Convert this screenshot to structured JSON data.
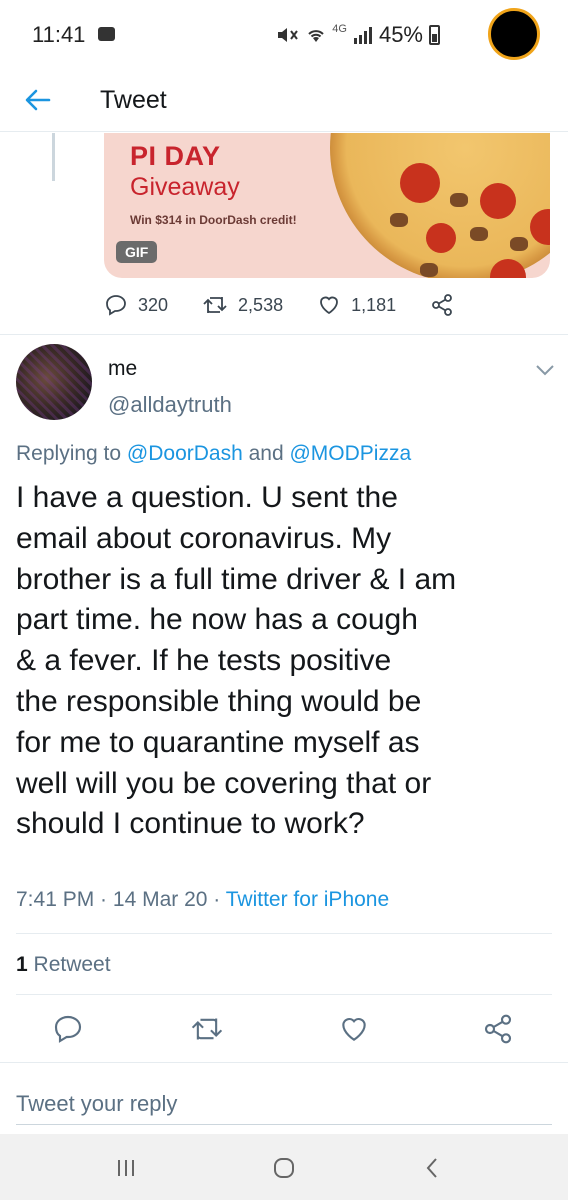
{
  "status_bar": {
    "time": "11:41",
    "network": "4G",
    "battery": "45%"
  },
  "header": {
    "title": "Tweet"
  },
  "quoted_card": {
    "title": "PI DAY",
    "subtitle": "Giveaway",
    "credit": "Win $314 in DoorDash credit!",
    "badge": "GIF"
  },
  "stats": {
    "replies": "320",
    "retweets": "2,538",
    "likes": "1,181"
  },
  "tweet": {
    "name": "me",
    "handle": "@alldaytruth",
    "replying_prefix": "Replying to ",
    "reply_to_1": "@DoorDash",
    "reply_and": " and ",
    "reply_to_2": "@MODPizza",
    "body": "I have a question. U sent the\nemail about coronavirus. My\nbrother is a full time driver & I am\npart time. he now has a cough\n& a fever. If he tests positive\nthe responsible thing would be\nfor me to quarantine myself as\nwell will you be covering that or\nshould I continue to work?",
    "time": "7:41 PM",
    "date": "14 Mar 20",
    "separator": " · ",
    "source": "Twitter for iPhone",
    "retweet_count": "1",
    "retweet_label": " Retweet"
  },
  "reply_box": {
    "placeholder": "Tweet your reply"
  },
  "colors": {
    "link": "#1b95e0",
    "secondary_text": "#5b7083",
    "divider": "#e6ecf0",
    "promo_red": "#c8242d"
  }
}
